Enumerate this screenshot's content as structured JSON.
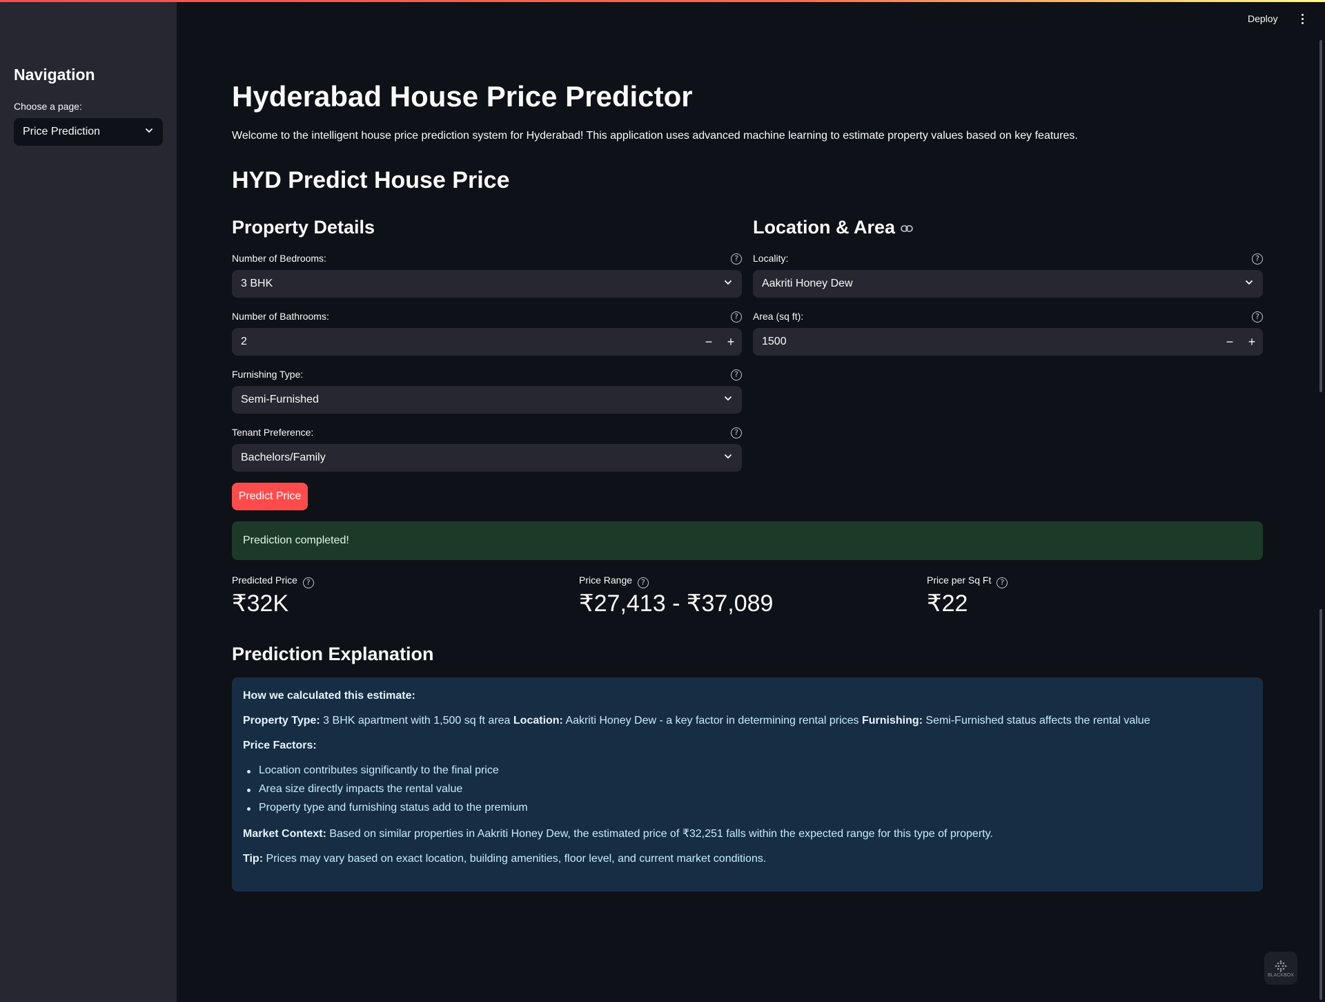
{
  "header": {
    "deploy_label": "Deploy"
  },
  "sidebar": {
    "title": "Navigation",
    "page_label": "Choose a page:",
    "page_value": "Price Prediction"
  },
  "main": {
    "title": "Hyderabad House Price Predictor",
    "intro": "Welcome to the intelligent house price prediction system for Hyderabad! This application uses advanced machine learning to estimate property values based on key features.",
    "subtitle": "HYD Predict House Price",
    "property_details": {
      "heading": "Property Details",
      "bedrooms_label": "Number of Bedrooms:",
      "bedrooms_value": "3 BHK",
      "bathrooms_label": "Number of Bathrooms:",
      "bathrooms_value": "2",
      "furnishing_label": "Furnishing Type:",
      "furnishing_value": "Semi-Furnished",
      "tenant_label": "Tenant Preference:",
      "tenant_value": "Bachelors/Family"
    },
    "location_area": {
      "heading": "Location & Area",
      "locality_label": "Locality:",
      "locality_value": "Aakriti Honey Dew",
      "area_label": "Area (sq ft):",
      "area_value": "1500"
    },
    "predict_button": "Predict Price",
    "success_message": "Prediction completed!",
    "metrics": {
      "predicted_price_label": "Predicted Price",
      "predicted_price_value": "₹32K",
      "price_range_label": "Price Range",
      "price_range_value": "₹27,413 - ₹37,089",
      "price_per_sqft_label": "Price per Sq Ft",
      "price_per_sqft_value": "₹22"
    },
    "explanation": {
      "heading": "Prediction Explanation",
      "how_title": "How we calculated this estimate:",
      "property_type_key": "Property Type:",
      "property_type_text": " 3 BHK apartment with 1,500 sq ft area ",
      "location_key": "Location:",
      "location_text": " Aakriti Honey Dew - a key factor in determining rental prices ",
      "furnishing_key": "Furnishing:",
      "furnishing_text": " Semi-Furnished status affects the rental value",
      "factors_title": "Price Factors:",
      "factors": [
        "Location contributes significantly to the final price",
        "Area size directly impacts the rental value",
        "Property type and furnishing status add to the premium"
      ],
      "market_key": "Market Context:",
      "market_text": " Based on similar properties in Aakriti Honey Dew, the estimated price of ₹32,251 falls within the expected range for this type of property.",
      "tip_key": "Tip:",
      "tip_text": " Prices may vary based on exact location, building amenities, floor level, and current market conditions."
    }
  },
  "badge": {
    "label": "BLACKBOX"
  },
  "colors": {
    "background": "#0e1117",
    "sidebar": "#262730",
    "accent": "#ff4b4b",
    "success_bg": "#1c3a28",
    "info_bg": "#172d43"
  }
}
